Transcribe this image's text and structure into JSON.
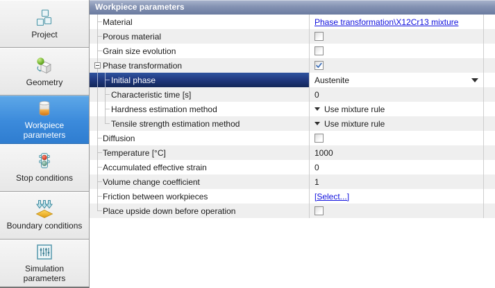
{
  "sidebar": {
    "items": [
      {
        "label": "Project",
        "icon": "project-documents-icon",
        "selected": false
      },
      {
        "label": "Geometry",
        "icon": "geometry-cube-icon",
        "selected": false
      },
      {
        "label": "Workpiece parameters",
        "icon": "workpiece-cylinder-icon",
        "selected": true
      },
      {
        "label": "Stop conditions",
        "icon": "traffic-light-icon",
        "selected": false
      },
      {
        "label": "Boundary conditions",
        "icon": "boundary-arrows-icon",
        "selected": false
      },
      {
        "label": "Simulation parameters",
        "icon": "simulation-sliders-icon",
        "selected": false
      }
    ]
  },
  "panel": {
    "title": "Workpiece parameters",
    "rows": [
      {
        "name": "Material",
        "level": 0,
        "type": "link",
        "value": "Phase transformation\\X12Cr13 mixture"
      },
      {
        "name": "Porous material",
        "level": 0,
        "type": "checkbox",
        "checked": false
      },
      {
        "name": "Grain size evolution",
        "level": 0,
        "type": "checkbox",
        "checked": false
      },
      {
        "name": "Phase transformation",
        "level": 0,
        "type": "checkbox",
        "checked": true,
        "expander": "minus"
      },
      {
        "name": "Initial phase",
        "level": 1,
        "type": "dropdown",
        "value": "Austenite",
        "selected": true
      },
      {
        "name": "Characteristic time [s]",
        "level": 1,
        "type": "text",
        "value": "0"
      },
      {
        "name": "Hardness estimation method",
        "level": 1,
        "type": "collapsed_dropdown",
        "value": "Use mixture rule"
      },
      {
        "name": "Tensile strength estimation method",
        "level": 1,
        "type": "collapsed_dropdown",
        "value": "Use mixture rule",
        "last_child": true
      },
      {
        "name": "Diffusion",
        "level": 0,
        "type": "checkbox",
        "checked": false
      },
      {
        "name": "Temperature [°C]",
        "level": 0,
        "type": "text",
        "value": "1000"
      },
      {
        "name": "Accumulated effective strain",
        "level": 0,
        "type": "text",
        "value": "0"
      },
      {
        "name": "Volume change coefficient",
        "level": 0,
        "type": "text",
        "value": "1"
      },
      {
        "name": "Friction between workpieces",
        "level": 0,
        "type": "link",
        "value": "[Select...]"
      },
      {
        "name": "Place upside down before operation",
        "level": 0,
        "type": "checkbox",
        "checked": false
      }
    ]
  },
  "colors": {
    "selected_nav_blue": "#3b8adb",
    "selected_row_navy": "#20387e",
    "header_gradient_top": "#a9b5cd",
    "header_gradient_bottom": "#6a7ba0",
    "link_blue": "#0f0fdd",
    "row_alt_gray": "#efefef",
    "checkbox_check_blue": "#3a6db8",
    "workpiece_icon_orange": "#d2720e",
    "boundary_icon_yellow": "#e8a81c",
    "traffic_red": "#cf2c16",
    "traffic_green": "#55937e"
  }
}
